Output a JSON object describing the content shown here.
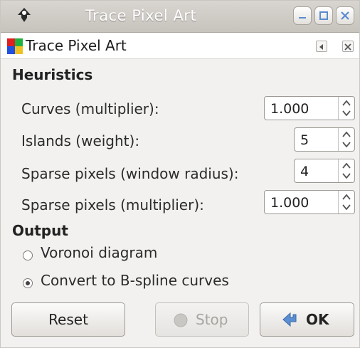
{
  "window": {
    "title": "Trace Pixel Art"
  },
  "dialog": {
    "title": "Trace Pixel Art"
  },
  "heuristics": {
    "heading": "Heuristics",
    "rows": [
      {
        "label": "Curves (multiplier):",
        "value": "1.000"
      },
      {
        "label": "Islands (weight):",
        "value": "5"
      },
      {
        "label": "Sparse pixels (window radius):",
        "value": "4"
      },
      {
        "label": "Sparse pixels (multiplier):",
        "value": "1.000"
      }
    ]
  },
  "output": {
    "heading": "Output",
    "options": [
      {
        "label": "Voronoi diagram",
        "selected": false
      },
      {
        "label": "Convert to B-spline curves",
        "selected": true
      }
    ]
  },
  "buttons": {
    "reset": "Reset",
    "stop": "Stop",
    "ok": "OK"
  }
}
